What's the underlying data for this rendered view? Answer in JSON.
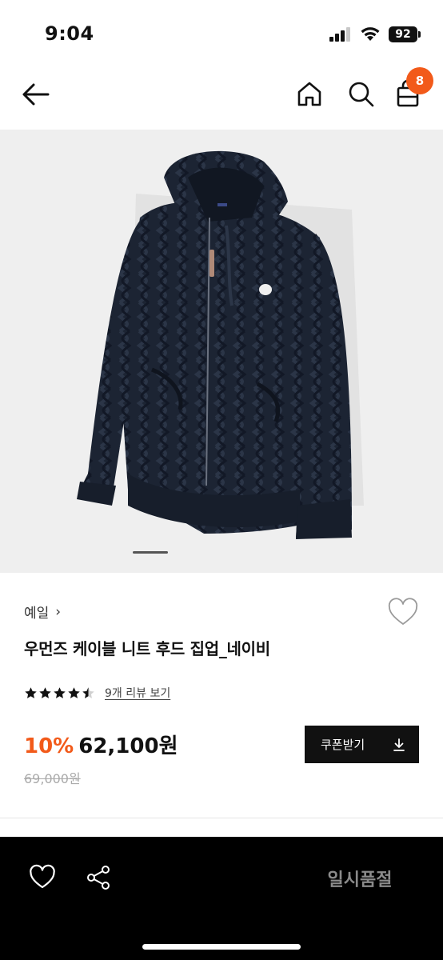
{
  "status_bar": {
    "time": "9:04",
    "battery": "92",
    "icons": [
      "signal-icon",
      "wifi-icon",
      "battery-icon"
    ]
  },
  "nav": {
    "icons": [
      "back-arrow-icon",
      "home-icon",
      "search-icon",
      "shopping-bag-icon"
    ],
    "cart_count": "8",
    "accent_color": "#f25a1a"
  },
  "product": {
    "image": "navy cable-knit hooded zip-up cardigan",
    "carousel_page": 1,
    "brand": "예일",
    "title": "우먼즈 케이블 니트 후드 집업_네이비",
    "rating": 4.5,
    "review_text": "9개 리뷰 보기",
    "discount": "10%",
    "price": "62,100원",
    "original_price": "69,000원",
    "coupon_label": "쿠폰받기"
  },
  "bottom_bar": {
    "icons": [
      "heart-icon",
      "share-icon"
    ],
    "soldout_label": "일시품절"
  }
}
